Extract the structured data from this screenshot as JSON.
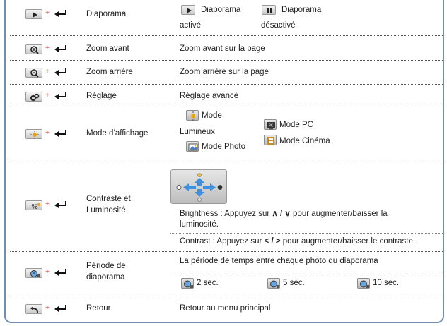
{
  "rows": [
    {
      "button_icon": "play-icon",
      "label": "Diaporama",
      "desc": {
        "on_title": "Diaporama",
        "on_sub": "activé",
        "off_title": "Diaporama",
        "off_sub": "désactivé",
        "on_icon": "play-icon",
        "off_icon": "pause-icon"
      }
    },
    {
      "button_icon": "zoom-in-icon",
      "label": "Zoom avant",
      "desc": "Zoom avant sur la page"
    },
    {
      "button_icon": "zoom-out-icon",
      "label": "Zoom arrière",
      "desc": "Zoom arrière sur la page"
    },
    {
      "button_icon": "settings-icon",
      "label": "Réglage",
      "desc": "Réglage avancé"
    },
    {
      "button_icon": "display-mode-icon",
      "label": "Mode d’affichage",
      "desc": {
        "modes": [
          {
            "icon": "sun-mode-icon",
            "line1": "Mode",
            "line2": "Lumineux"
          },
          {
            "icon": "photo-mode-icon",
            "line1": "Mode Photo"
          },
          {
            "icon": "pc-mode-icon",
            "line1": "Mode PC"
          },
          {
            "icon": "cinema-mode-icon",
            "line1": "Mode Cinéma"
          }
        ]
      }
    },
    {
      "button_icon": "contrast-brightness-icon",
      "label_line1": "Contraste et",
      "label_line2": "Luminosité",
      "desc": {
        "pad_icon": "navigation-pad-icon",
        "brightness_prefix": "Brightness : Appuyez sur",
        "brightness_keys": "∧ / ∨",
        "brightness_suffix": "pour augmenter/baisser la",
        "brightness_line2": "luminosité.",
        "contrast_prefix": "Contrast : Appuyez sur",
        "contrast_keys": "< / >",
        "contrast_suffix": "pour augmenter/baisser le contraste."
      }
    },
    {
      "button_icon": "timer-icon",
      "label_line1": "Période de",
      "label_line2": "diaporama",
      "desc": {
        "text": "La période de temps entre chaque photo du diaporama",
        "options": [
          "2 sec.",
          "5 sec.",
          "10 sec."
        ]
      }
    },
    {
      "button_icon": "return-icon",
      "label": "Retour",
      "desc": "Retour au menu principal"
    }
  ],
  "plus_sign": "+",
  "colors": {
    "frame": "#6f8fb2",
    "plus": "#e0443a"
  }
}
